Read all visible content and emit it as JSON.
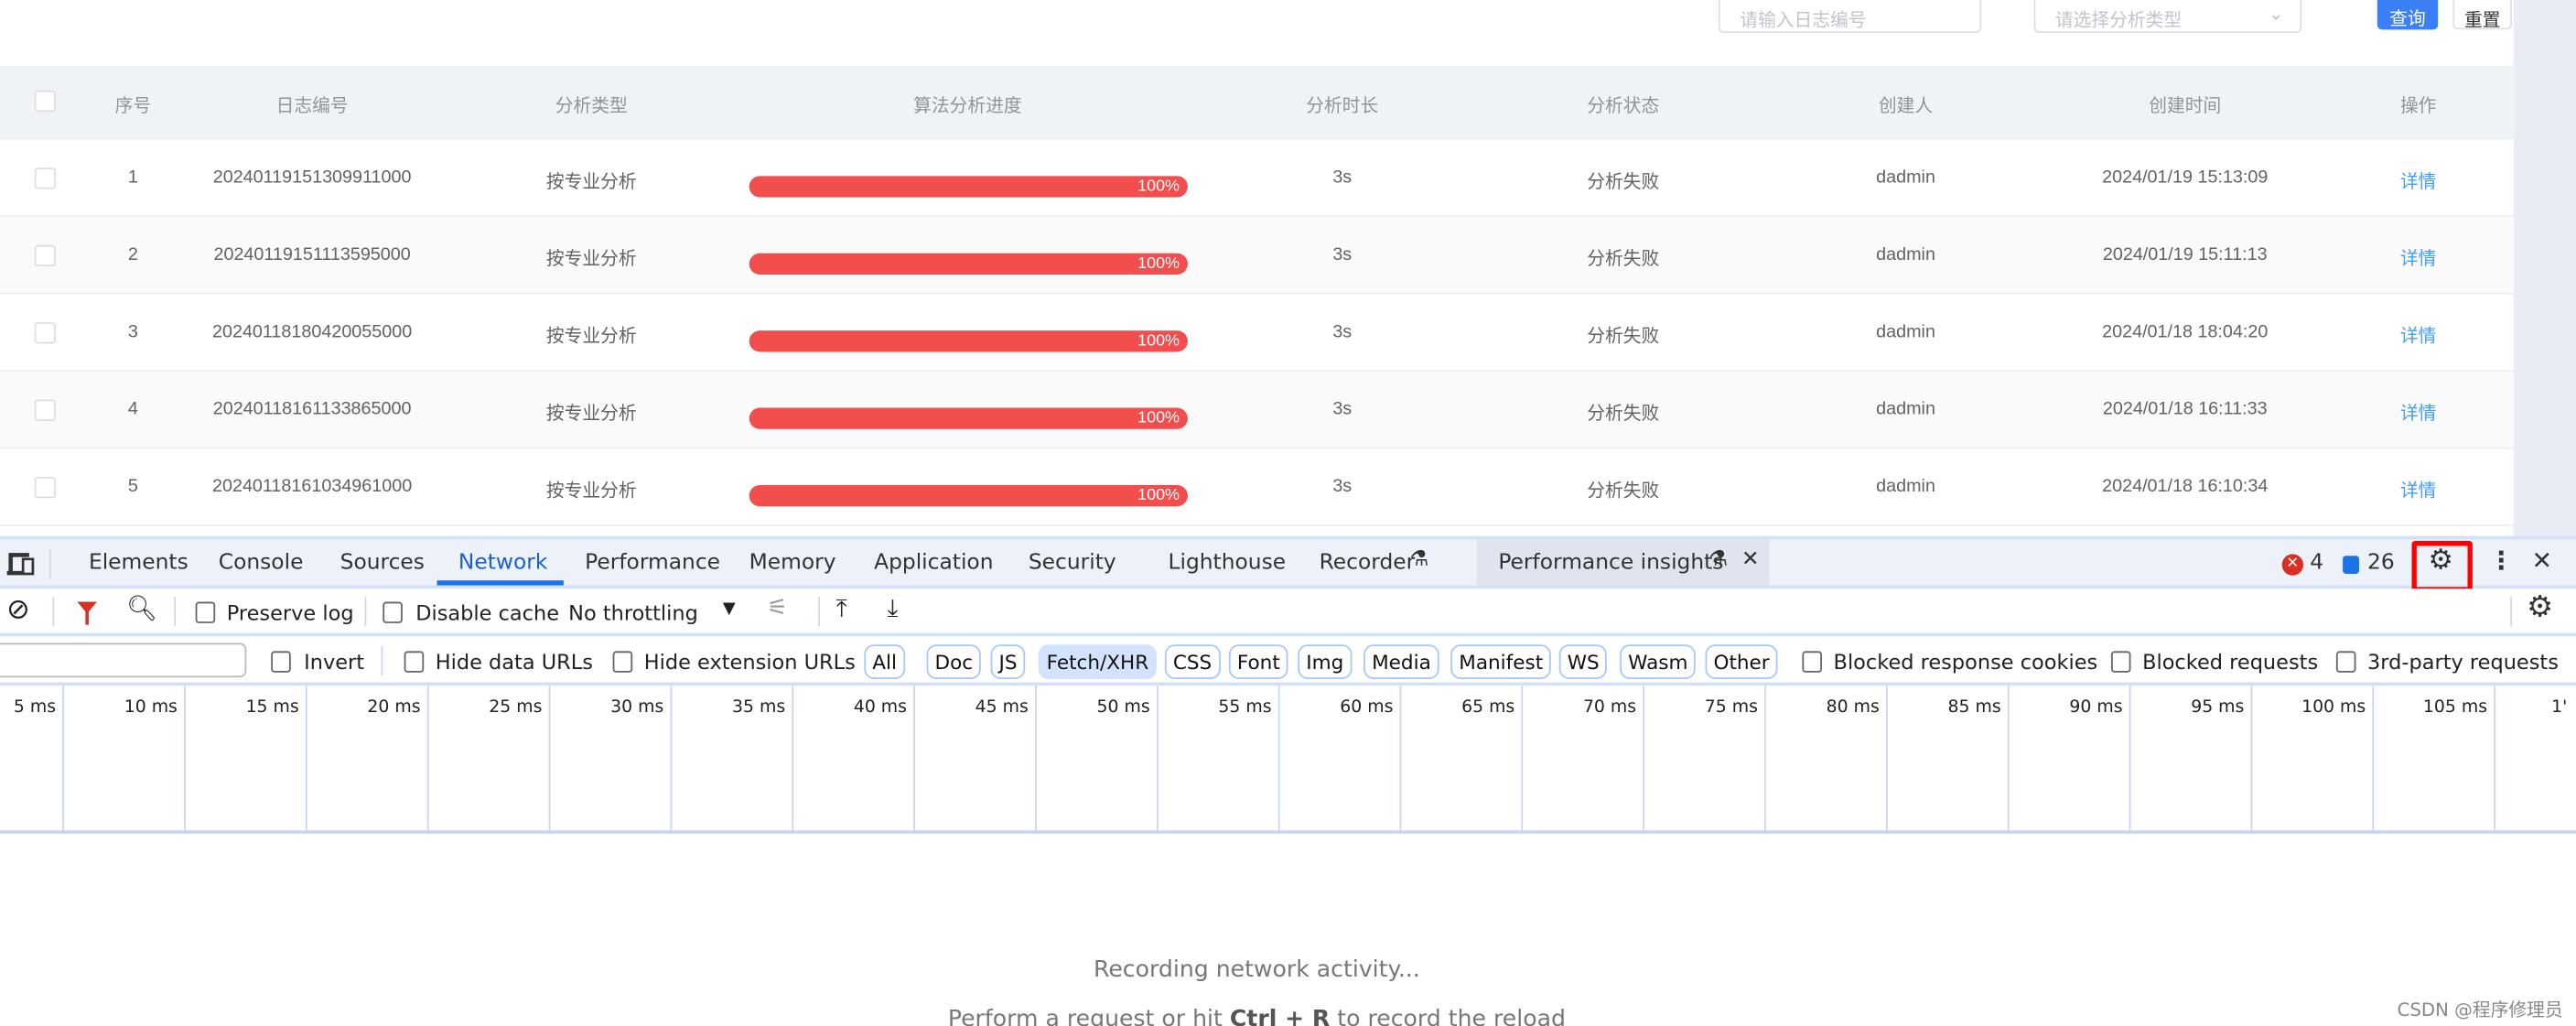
{
  "filters": {
    "log_no_placeholder": "请输入日志编号",
    "type_placeholder": "请选择分析类型",
    "query_label": "查询",
    "reset_label": "重置"
  },
  "colors": {
    "primary": "#3a7ff6",
    "progress": "#f24e4e",
    "link": "#409eff",
    "highlight_box": "#ff0000"
  },
  "table": {
    "headers": [
      "序号",
      "日志编号",
      "分析类型",
      "算法分析进度",
      "分析时长",
      "分析状态",
      "创建人",
      "创建时间",
      "操作"
    ],
    "rows": [
      {
        "index": "1",
        "log_no": "20240119151309911000",
        "type": "按专业分析",
        "progress": 100,
        "progress_label": "100%",
        "duration": "3s",
        "status": "分析失败",
        "creator": "dadmin",
        "created": "2024/01/19 15:13:09",
        "action": "详情"
      },
      {
        "index": "2",
        "log_no": "20240119151113595000",
        "type": "按专业分析",
        "progress": 100,
        "progress_label": "100%",
        "duration": "3s",
        "status": "分析失败",
        "creator": "dadmin",
        "created": "2024/01/19 15:11:13",
        "action": "详情"
      },
      {
        "index": "3",
        "log_no": "20240118180420055000",
        "type": "按专业分析",
        "progress": 100,
        "progress_label": "100%",
        "duration": "3s",
        "status": "分析失败",
        "creator": "dadmin",
        "created": "2024/01/18 18:04:20",
        "action": "详情"
      },
      {
        "index": "4",
        "log_no": "20240118161133865000",
        "type": "按专业分析",
        "progress": 100,
        "progress_label": "100%",
        "duration": "3s",
        "status": "分析失败",
        "creator": "dadmin",
        "created": "2024/01/18 16:11:33",
        "action": "详情"
      },
      {
        "index": "5",
        "log_no": "20240118161034961000",
        "type": "按专业分析",
        "progress": 100,
        "progress_label": "100%",
        "duration": "3s",
        "status": "分析失败",
        "creator": "dadmin",
        "created": "2024/01/18 16:10:34",
        "action": "详情"
      }
    ]
  },
  "devtools": {
    "tabs": [
      "Elements",
      "Console",
      "Sources",
      "Network",
      "Performance",
      "Memory",
      "Application",
      "Security",
      "Lighthouse",
      "Recorder",
      "Performance insights"
    ],
    "active_tab": "Network",
    "error_count": "4",
    "message_count": "26",
    "toolbar": {
      "preserve_log": "Preserve log",
      "disable_cache": "Disable cache",
      "throttling": "No throttling"
    },
    "filter": {
      "invert": "Invert",
      "hide_data_urls": "Hide data URLs",
      "hide_extension_urls": "Hide extension URLs",
      "types": [
        "All",
        "Doc",
        "JS",
        "Fetch/XHR",
        "CSS",
        "Font",
        "Img",
        "Media",
        "Manifest",
        "WS",
        "Wasm",
        "Other"
      ],
      "active_type": "Fetch/XHR",
      "blocked_cookies": "Blocked response cookies",
      "blocked_requests": "Blocked requests",
      "third_party": "3rd-party requests"
    },
    "timeline_ticks": [
      "5 ms",
      "10 ms",
      "15 ms",
      "20 ms",
      "25 ms",
      "30 ms",
      "35 ms",
      "40 ms",
      "45 ms",
      "50 ms",
      "55 ms",
      "60 ms",
      "65 ms",
      "70 ms",
      "75 ms",
      "80 ms",
      "85 ms",
      "90 ms",
      "95 ms",
      "100 ms",
      "105 ms",
      "1'"
    ],
    "recording": "Recording network activity...",
    "hint_pre": "Perform a request or hit ",
    "hint_key": "Ctrl + R",
    "hint_post": " to record the reload"
  },
  "watermark": "CSDN @程序修理员"
}
